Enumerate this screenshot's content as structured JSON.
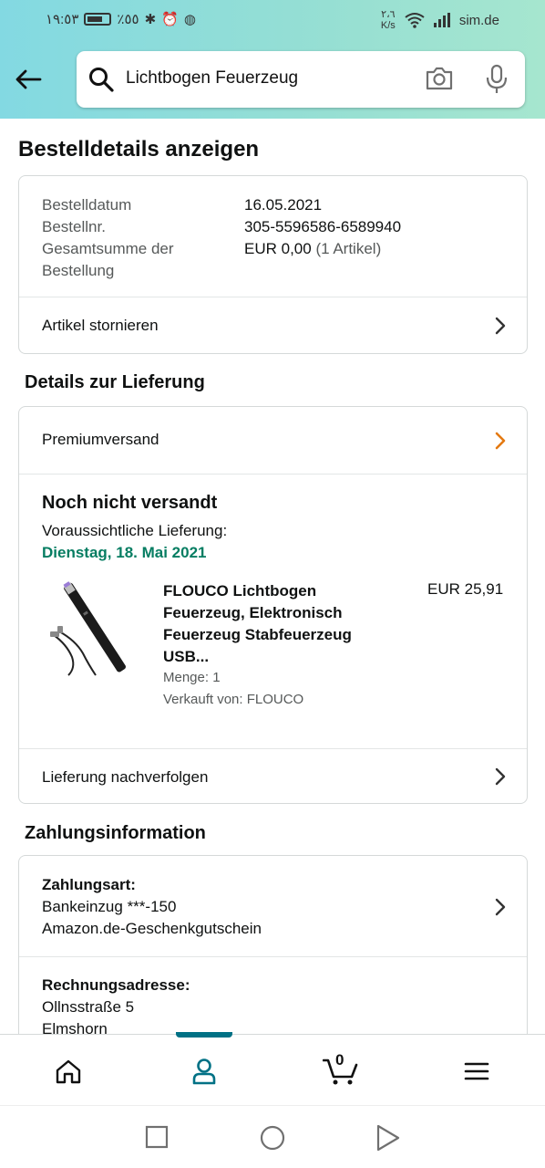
{
  "status_bar": {
    "time": "١٩:٥٣",
    "battery_pct": "٪٥٥",
    "net_speed_value": "٢،٦",
    "net_speed_unit": "K/s",
    "carrier": "sim.de"
  },
  "search": {
    "query": "Lichtbogen Feuerzeug"
  },
  "page_title": "Bestelldetails anzeigen",
  "order_summary": {
    "rows": [
      {
        "label": "Bestelldatum",
        "value": "16.05.2021"
      },
      {
        "label": "Bestellnr.",
        "value": "305-5596586-6589940"
      },
      {
        "label": "Gesamtsumme der Bestellung",
        "value": "EUR 0,00",
        "value_extra": "(1 Artikel)"
      }
    ],
    "cancel_label": "Artikel stornieren"
  },
  "delivery": {
    "section_title": "Details zur Lieferung",
    "shipping_method": "Premiumversand",
    "status": "Noch nicht versandt",
    "expected_label": "Voraussichtliche Lieferung:",
    "expected_date": "Dienstag, 18. Mai 2021",
    "product": {
      "title": "FLOUCO Lichtbogen Feuerzeug, Elektronisch Feuerzeug Stabfeuerzeug USB...",
      "price": "EUR 25,91",
      "quantity": "Menge: 1",
      "seller": "Verkauft von: FLOUCO"
    },
    "track_label": "Lieferung nachverfolgen"
  },
  "payment": {
    "section_title": "Zahlungsinformation",
    "method_label": "Zahlungsart:",
    "method_line1": "Bankeinzug ***-150",
    "method_line2": "Amazon.de-Geschenkgutschein",
    "billing_label": "Rechnungsadresse:",
    "billing_line1": "Ollnsstraße 5",
    "billing_line2": "Elmshorn"
  },
  "bottom_nav": {
    "items": [
      "home-icon",
      "account-icon",
      "cart-icon",
      "menu-icon"
    ],
    "active": "account-icon",
    "cart_count": "0"
  },
  "colors": {
    "accent": "#007185",
    "delivery_green": "#067d62",
    "orange_chevron": "#e47911"
  }
}
